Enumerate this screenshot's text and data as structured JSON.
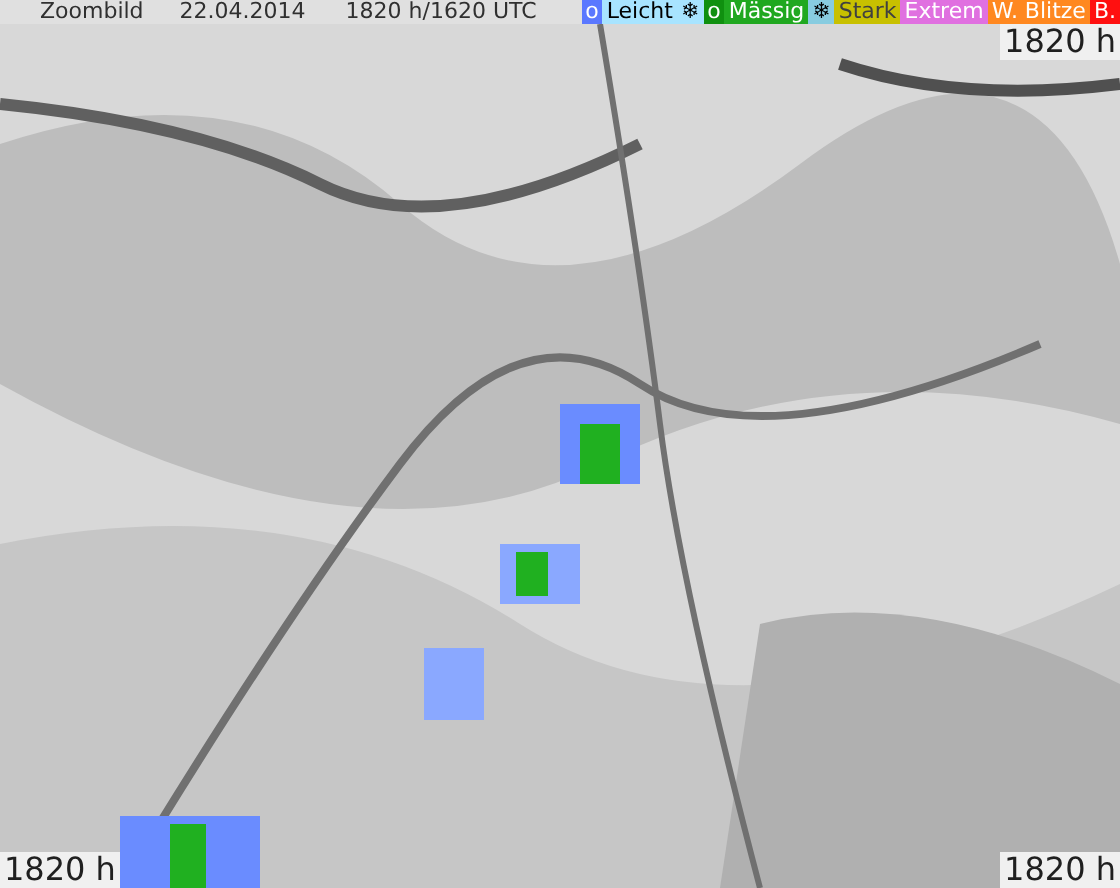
{
  "header": {
    "title": "Zoombild",
    "date": "22.04.2014",
    "time": "1820 h/1620 UTC"
  },
  "legend": [
    {
      "text": "o",
      "color": "#5a78ff"
    },
    {
      "text": "Leicht",
      "color": "#a8e4ff"
    },
    {
      "text": "❄",
      "color": "#a8e4ff"
    },
    {
      "text": "o",
      "color": "#109010"
    },
    {
      "text": "Mässig",
      "color": "#20a820"
    },
    {
      "text": "❄",
      "color": "#88cce0"
    },
    {
      "text": "Stark",
      "color": "#c8c000"
    },
    {
      "text": "Extrem",
      "color": "#e070e0"
    },
    {
      "text": "W. Blitze",
      "color": "#ff8820"
    },
    {
      "text": "B.",
      "color": "#ff1010"
    }
  ],
  "map": {
    "kind": "picture",
    "corner_labels": [
      "1820 h",
      "1820 h",
      "1820 h"
    ]
  }
}
